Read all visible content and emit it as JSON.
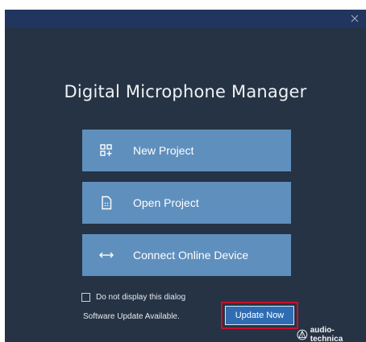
{
  "window": {
    "close_icon": "close-icon"
  },
  "app": {
    "title": "Digital Microphone Manager"
  },
  "actions": [
    {
      "label": "New Project",
      "icon": "new-project-icon"
    },
    {
      "label": "Open Project",
      "icon": "open-project-icon"
    },
    {
      "label": "Connect Online Device",
      "icon": "bidirectional-arrow-icon"
    }
  ],
  "options": {
    "do_not_display_label": "Do not display this dialog",
    "do_not_display_checked": false
  },
  "update": {
    "status_text": "Software Update Available.",
    "button_label": "Update Now",
    "highlight_color": "#c8102e"
  },
  "brand": {
    "name": "audio-technica",
    "logo_icon": "audio-technica-logo-icon"
  },
  "colors": {
    "background": "#263344",
    "titlebar": "#22355f",
    "action_button": "#5f8fbd",
    "update_button": "#2f6db3"
  }
}
